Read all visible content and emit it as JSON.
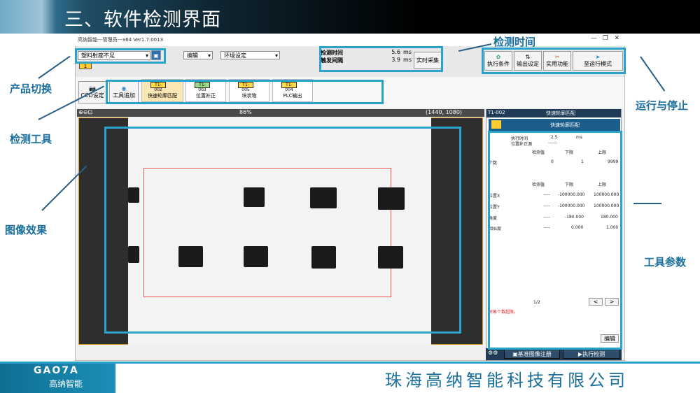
{
  "slide": {
    "title": "三、软件检测界面",
    "company": "珠海高纳智能科技有限公司",
    "logo_text": "GAO7A",
    "logo_sub": "高纳智能"
  },
  "window": {
    "title": "高纳智能---管理员---x64 Ver1.7.0013"
  },
  "toolbar": {
    "product_select": "塑料射座不足",
    "edit_menu": "编辑",
    "env_menu": "环境设定",
    "detect_time_label": "检测时间",
    "detect_time": "5.6",
    "trigger_label": "触发间隔",
    "trigger": "3.9",
    "unit_ms": "ms",
    "realtime_button": "实时采集",
    "exec_cond": "执行条件",
    "output_set": "输出设定",
    "utility": "实用功能",
    "run_mode": "至运行模式",
    "badge": "1"
  },
  "tools": {
    "ccd": "CCD设定",
    "add": "工具追加",
    "items": [
      {
        "tag": "T1-002",
        "label": "快速轮廓匹配"
      },
      {
        "tag": "T1-003",
        "label": "位置补正"
      },
      {
        "tag": "T1-005",
        "label": "块状物"
      },
      {
        "tag": "T1-004",
        "label": "PLC输出"
      }
    ]
  },
  "viewer": {
    "zoom": "86%",
    "coords": "(1440, 1080)"
  },
  "panel": {
    "header_tag": "T1-002",
    "header_title": "快速轮廓匹配",
    "tool_name": "快速轮廓匹配",
    "exec_time_label": "执行时间",
    "exec_time": "2.5",
    "exec_unit": "ms",
    "pos_label": "位置补正源",
    "pos_value": "------",
    "col_detect": "检测值",
    "col_low": "下限",
    "col_high": "上限",
    "count_label": "个数",
    "count_val": "0",
    "count_low": "1",
    "count_high": "9999",
    "rows": [
      {
        "name": "位置X",
        "val": "----",
        "low": "-100000.000",
        "high": "100000.000"
      },
      {
        "name": "位置Y",
        "val": "----",
        "low": "-100000.000",
        "high": "100000.000"
      },
      {
        "name": "角度",
        "val": "----",
        "low": "-180.000",
        "high": "180.000"
      },
      {
        "name": "相似度",
        "val": "----",
        "low": "0.000",
        "high": "1.000"
      }
    ],
    "page": "1/2",
    "prev": "<",
    "next": ">",
    "error": "对象个数超限。",
    "edit": "编辑",
    "register": "基准图像注册",
    "exec": "执行检测"
  },
  "annotations": {
    "product_switch": "产品切换",
    "detect_tool": "检测工具",
    "image_effect": "图像效果",
    "detect_time": "检测时间",
    "run_stop": "运行与停止",
    "tool_params": "工具参数"
  }
}
